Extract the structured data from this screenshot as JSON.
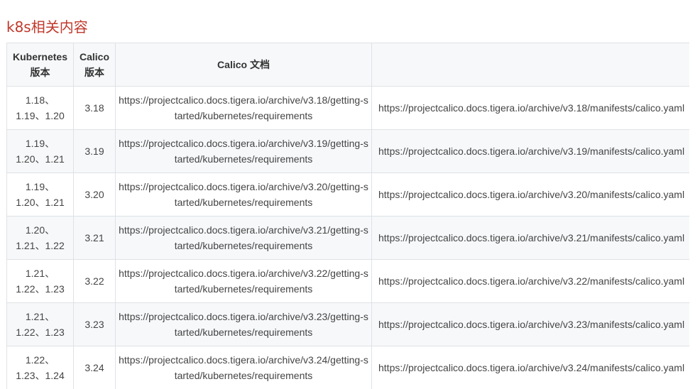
{
  "heading": "k8s相关内容",
  "table": {
    "headers": {
      "k8s_version": "Kubernetes 版本",
      "calico_version": "Calico 版本",
      "calico_docs": "Calico 文档",
      "manifest": ""
    },
    "rows": [
      {
        "k8s_versions": "1.18、1.19、1.20",
        "calico_version": "3.18",
        "docs_url": "https://projectcalico.docs.tigera.io/archive/v3.18/getting-started/kubernetes/requirements",
        "manifest_url": "https://projectcalico.docs.tigera.io/archive/v3.18/manifests/calico.yaml"
      },
      {
        "k8s_versions": "1.19、1.20、1.21",
        "calico_version": "3.19",
        "docs_url": "https://projectcalico.docs.tigera.io/archive/v3.19/getting-started/kubernetes/requirements",
        "manifest_url": "https://projectcalico.docs.tigera.io/archive/v3.19/manifests/calico.yaml"
      },
      {
        "k8s_versions": "1.19、1.20、1.21",
        "calico_version": "3.20",
        "docs_url": "https://projectcalico.docs.tigera.io/archive/v3.20/getting-started/kubernetes/requirements",
        "manifest_url": "https://projectcalico.docs.tigera.io/archive/v3.20/manifests/calico.yaml"
      },
      {
        "k8s_versions": "1.20、1.21、1.22",
        "calico_version": "3.21",
        "docs_url": "https://projectcalico.docs.tigera.io/archive/v3.21/getting-started/kubernetes/requirements",
        "manifest_url": "https://projectcalico.docs.tigera.io/archive/v3.21/manifests/calico.yaml"
      },
      {
        "k8s_versions": "1.21、1.22、1.23",
        "calico_version": "3.22",
        "docs_url": "https://projectcalico.docs.tigera.io/archive/v3.22/getting-started/kubernetes/requirements",
        "manifest_url": "https://projectcalico.docs.tigera.io/archive/v3.22/manifests/calico.yaml"
      },
      {
        "k8s_versions": "1.21、1.22、1.23",
        "calico_version": "3.23",
        "docs_url": "https://projectcalico.docs.tigera.io/archive/v3.23/getting-started/kubernetes/requirements",
        "manifest_url": "https://projectcalico.docs.tigera.io/archive/v3.23/manifests/calico.yaml"
      },
      {
        "k8s_versions": "1.22、1.23、1.24",
        "calico_version": "3.24",
        "docs_url": "https://projectcalico.docs.tigera.io/archive/v3.24/getting-started/kubernetes/requirements",
        "manifest_url": "https://projectcalico.docs.tigera.io/archive/v3.24/manifests/calico.yaml"
      }
    ]
  }
}
